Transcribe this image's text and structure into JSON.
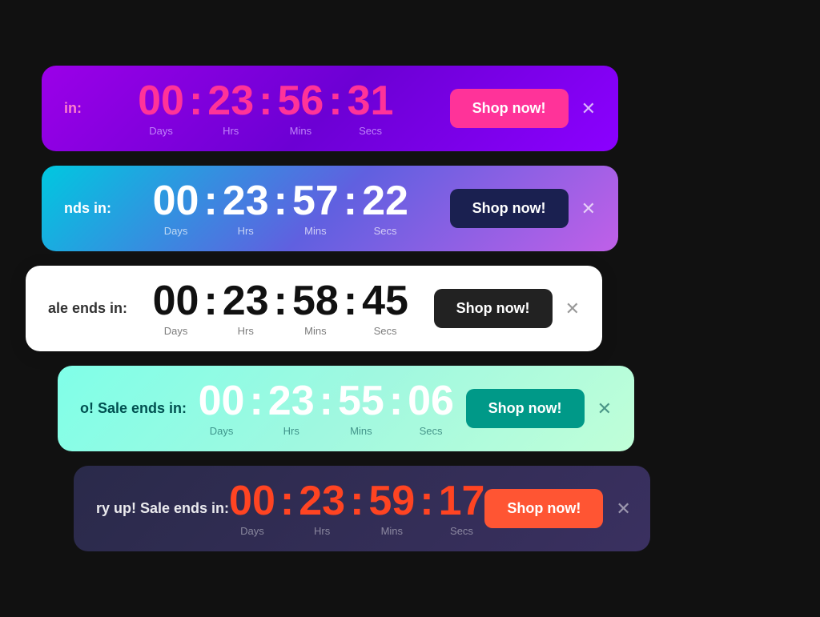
{
  "banners": [
    {
      "id": "banner-1",
      "label": "in:",
      "days": "00",
      "hrs": "23",
      "mins": "56",
      "secs": "31",
      "days_label": "Days",
      "hrs_label": "Hrs",
      "mins_label": "Mins",
      "secs_label": "Secs",
      "btn_label": "Shop now!",
      "theme": "banner-1"
    },
    {
      "id": "banner-2",
      "label": "nds in:",
      "days": "00",
      "hrs": "23",
      "mins": "57",
      "secs": "22",
      "days_label": "Days",
      "hrs_label": "Hrs",
      "mins_label": "Mins",
      "secs_label": "Secs",
      "btn_label": "Shop now!",
      "theme": "banner-2"
    },
    {
      "id": "banner-3",
      "label": "ale ends in:",
      "days": "00",
      "hrs": "23",
      "mins": "58",
      "secs": "45",
      "days_label": "Days",
      "hrs_label": "Hrs",
      "mins_label": "Mins",
      "secs_label": "Secs",
      "btn_label": "Shop now!",
      "theme": "banner-3"
    },
    {
      "id": "banner-4",
      "label": "o! Sale ends in:",
      "days": "00",
      "hrs": "23",
      "mins": "55",
      "secs": "06",
      "days_label": "Days",
      "hrs_label": "Hrs",
      "mins_label": "Mins",
      "secs_label": "Secs",
      "btn_label": "Shop now!",
      "theme": "banner-4"
    },
    {
      "id": "banner-5",
      "label": "ry up! Sale ends in:",
      "days": "00",
      "hrs": "23",
      "mins": "59",
      "secs": "17",
      "days_label": "Days",
      "hrs_label": "Hrs",
      "mins_label": "Mins",
      "secs_label": "Secs",
      "btn_label": "Shop now!",
      "theme": "banner-5"
    }
  ],
  "separator": ":"
}
